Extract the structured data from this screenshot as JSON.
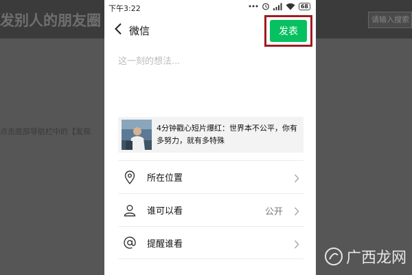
{
  "background_page": {
    "title": "发别人的朋友圈",
    "search_placeholder": "请输入搜索",
    "body_text": "点击底部导航栏中的【发现"
  },
  "status_bar": {
    "time": "下午3:22",
    "battery": "68"
  },
  "nav": {
    "back_icon": "chevron-left-icon",
    "title": "微信",
    "publish_label": "发表"
  },
  "compose": {
    "placeholder": "这一刻的想法..."
  },
  "shared_card": {
    "title": "4分钟戳心短片爆红：世界本不公平，你有多努力，就有多特殊"
  },
  "options": [
    {
      "icon": "location-pin-icon",
      "label": "所在位置",
      "value": ""
    },
    {
      "icon": "person-icon",
      "label": "谁可以看",
      "value": "公开"
    },
    {
      "icon": "at-sign-icon",
      "label": "提醒谁看",
      "value": ""
    }
  ],
  "watermark": {
    "text": "广西龙网"
  },
  "colors": {
    "publish_green": "#07c160",
    "highlight_frame": "#9d1c20",
    "overlay": "#5a5a5a"
  }
}
